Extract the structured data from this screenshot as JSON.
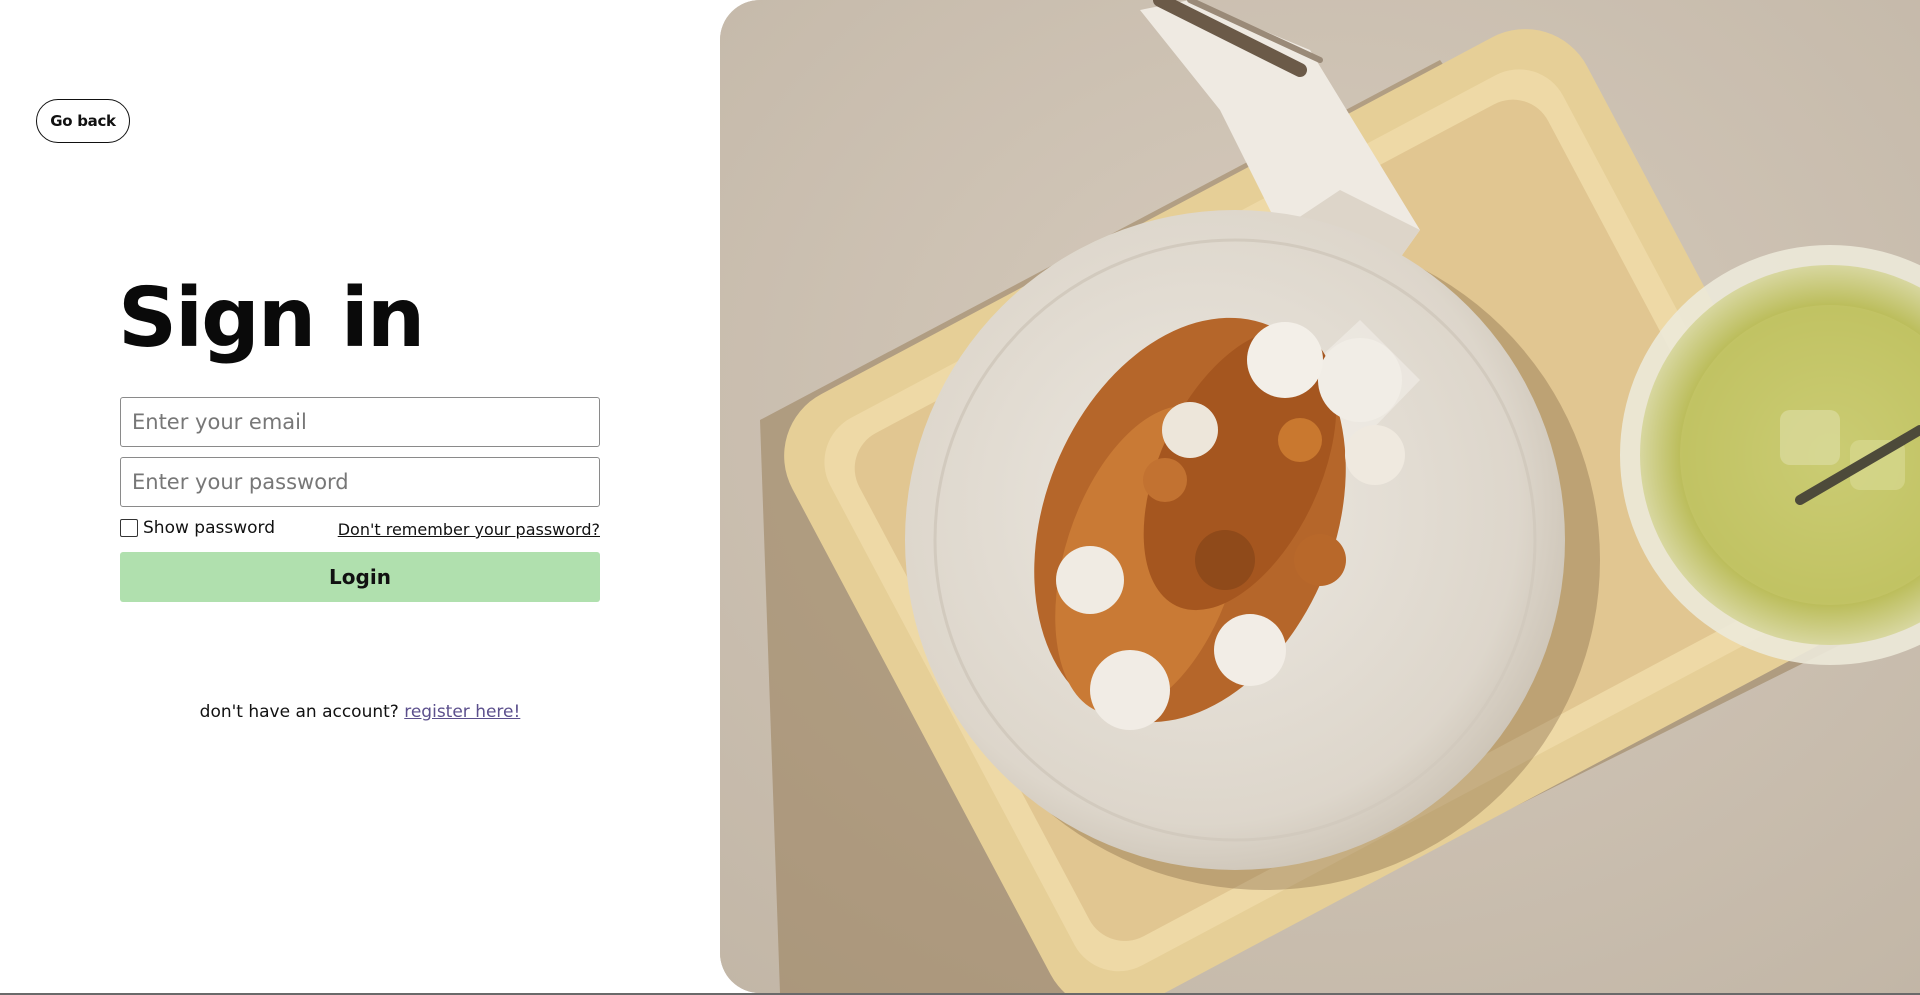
{
  "nav": {
    "go_back_label": "Go back"
  },
  "form": {
    "title": "Sign in",
    "email_placeholder": "Enter your email",
    "password_placeholder": "Enter your password",
    "show_password_label": "Show password",
    "forgot_password_label": "Don't remember your password?",
    "login_label": "Login"
  },
  "register": {
    "prompt": "don't have an account?",
    "link_label": "register here!"
  },
  "colors": {
    "login_button": "#b0e0ae",
    "register_link": "#5b4f8c"
  },
  "photo": {
    "description_icon": "dessert-photo"
  }
}
